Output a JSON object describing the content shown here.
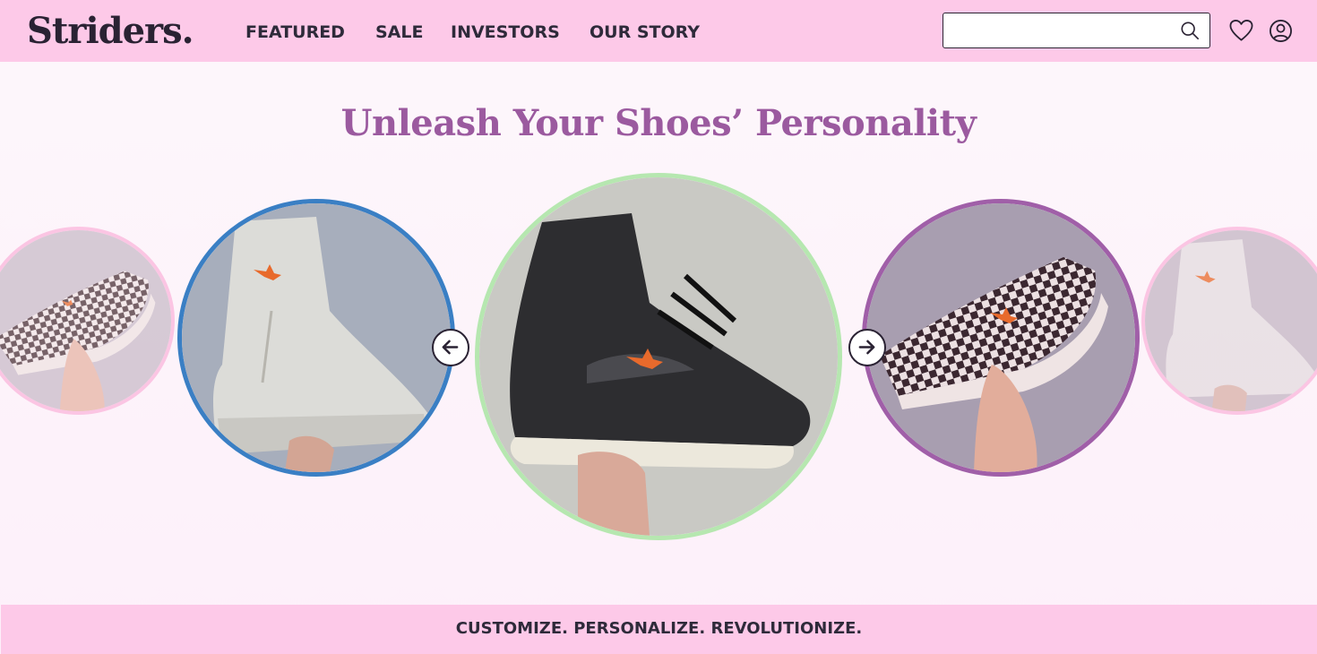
{
  "header": {
    "logo": "Striders.",
    "nav": [
      "FEATURED",
      "SALE",
      "INVESTORS",
      "OUR STORY"
    ],
    "search": {
      "placeholder": "",
      "value": ""
    },
    "icons": [
      "search-icon",
      "heart-icon",
      "user-icon"
    ]
  },
  "hero": {
    "headline": "Unleash Your Shoes’ Personality"
  },
  "carousel": {
    "slides": [
      {
        "position": "far-left",
        "image": "checkered slip-on shoe with butterfly pin",
        "border_color": "#fbb6dc"
      },
      {
        "position": "left",
        "image": "white high-top boot with butterfly pin",
        "border_color": "#3a7fc4"
      },
      {
        "position": "center",
        "image": "black high-top sneaker with butterfly pin",
        "border_color": "#b6e7b0"
      },
      {
        "position": "right",
        "image": "checkered slip-on shoe with butterfly pin",
        "border_color": "#a05fa8"
      },
      {
        "position": "far-right",
        "image": "white high-top boot with butterfly pin",
        "border_color": "#fbb6dc"
      }
    ],
    "controls": [
      "arrow-left-icon",
      "arrow-right-icon"
    ]
  },
  "band": {
    "tagline": "CUSTOMIZE. PERSONALIZE. REVOLUTIONIZE."
  },
  "colors": {
    "header_bg": "#fdc9e8",
    "headline": "#9b5a9f",
    "text_dark": "#2a2233",
    "page_bg": "#fdf4fa"
  }
}
